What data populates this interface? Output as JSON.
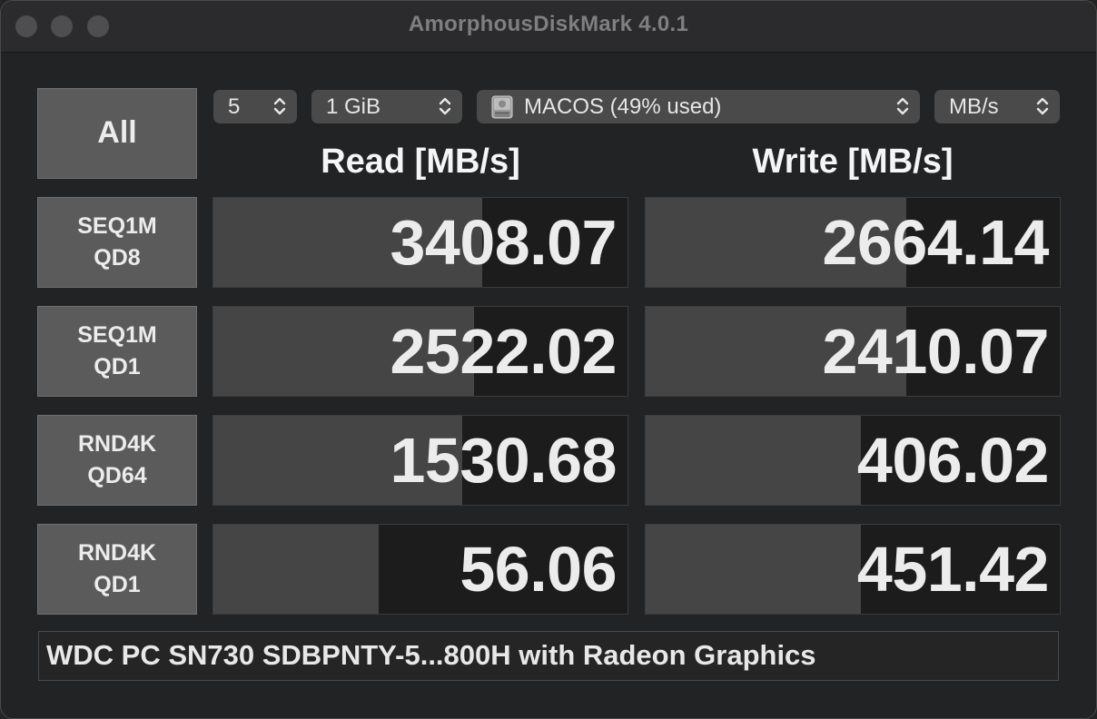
{
  "window": {
    "title": "AmorphousDiskMark 4.0.1"
  },
  "controls": {
    "all_label": "All",
    "count": "5",
    "size": "1 GiB",
    "drive": "MACOS (49% used)",
    "unit": "MB/s"
  },
  "headers": {
    "read": "Read [MB/s]",
    "write": "Write [MB/s]"
  },
  "tests": [
    {
      "label1": "SEQ1M",
      "label2": "QD8",
      "read": "3408.07",
      "write": "2664.14",
      "read_level": 0.65,
      "write_level": 0.63
    },
    {
      "label1": "SEQ1M",
      "label2": "QD1",
      "read": "2522.02",
      "write": "2410.07",
      "read_level": 0.63,
      "write_level": 0.63
    },
    {
      "label1": "RND4K",
      "label2": "QD64",
      "read": "1530.68",
      "write": "406.02",
      "read_level": 0.6,
      "write_level": 0.52
    },
    {
      "label1": "RND4K",
      "label2": "QD1",
      "read": "56.06",
      "write": "451.42",
      "read_level": 0.4,
      "write_level": 0.52
    }
  ],
  "comment": "WDC PC SN730 SDBPNTY-5...800H with Radeon Graphics",
  "icons": {
    "close": "close-icon",
    "minimize": "minimize-icon",
    "zoom": "zoom-icon",
    "chevron": "chevron-updown-icon",
    "disk": "hard-disk-icon"
  }
}
